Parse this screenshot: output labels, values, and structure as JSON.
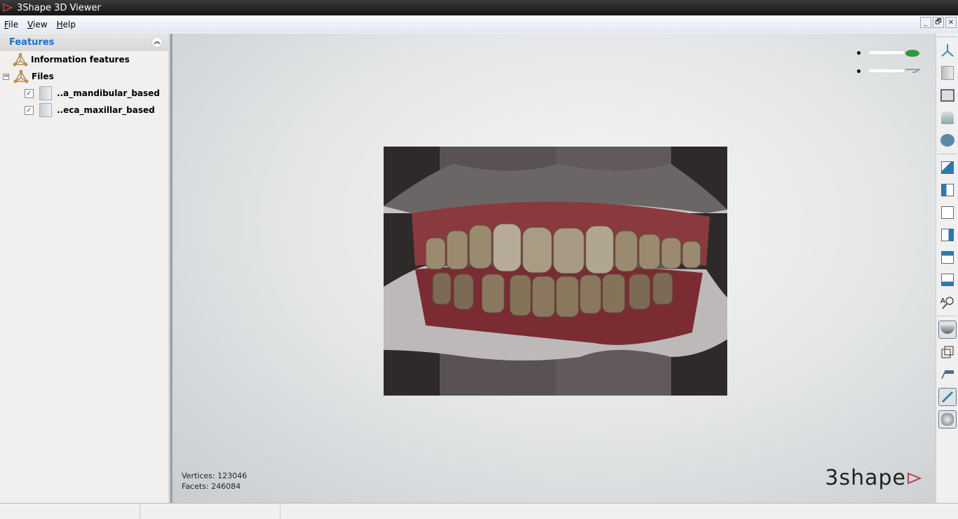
{
  "window": {
    "title": "3Shape 3D Viewer"
  },
  "menu": [
    "File",
    "View",
    "Help"
  ],
  "window_buttons": {
    "minimize": "_",
    "restore": "🗗",
    "close": "✕"
  },
  "panel": {
    "title": "Features",
    "items": [
      {
        "label": "Information features"
      },
      {
        "label": "Files",
        "children": [
          {
            "label": "..a_mandibular_based",
            "checked": true
          },
          {
            "label": "..eca_maxillar_based",
            "checked": true
          }
        ]
      }
    ]
  },
  "viewport": {
    "vertices_label": "Vertices: 123046",
    "facets_label": "Facets: 246084",
    "brand": "3shape"
  },
  "toolbar": [
    "axes-icon",
    "model-icon",
    "view-bottom-icon",
    "view-side-icon",
    "view-top-icon",
    "cube-front-icon",
    "cube-left-icon",
    "cube-back-icon",
    "cube-right-icon",
    "cube-top-icon",
    "cube-bottom-icon",
    "zoom-fit-icon",
    "shaded-icon",
    "wireframe-icon",
    "measure-icon",
    "clipping-icon",
    "occlusion-icon"
  ]
}
